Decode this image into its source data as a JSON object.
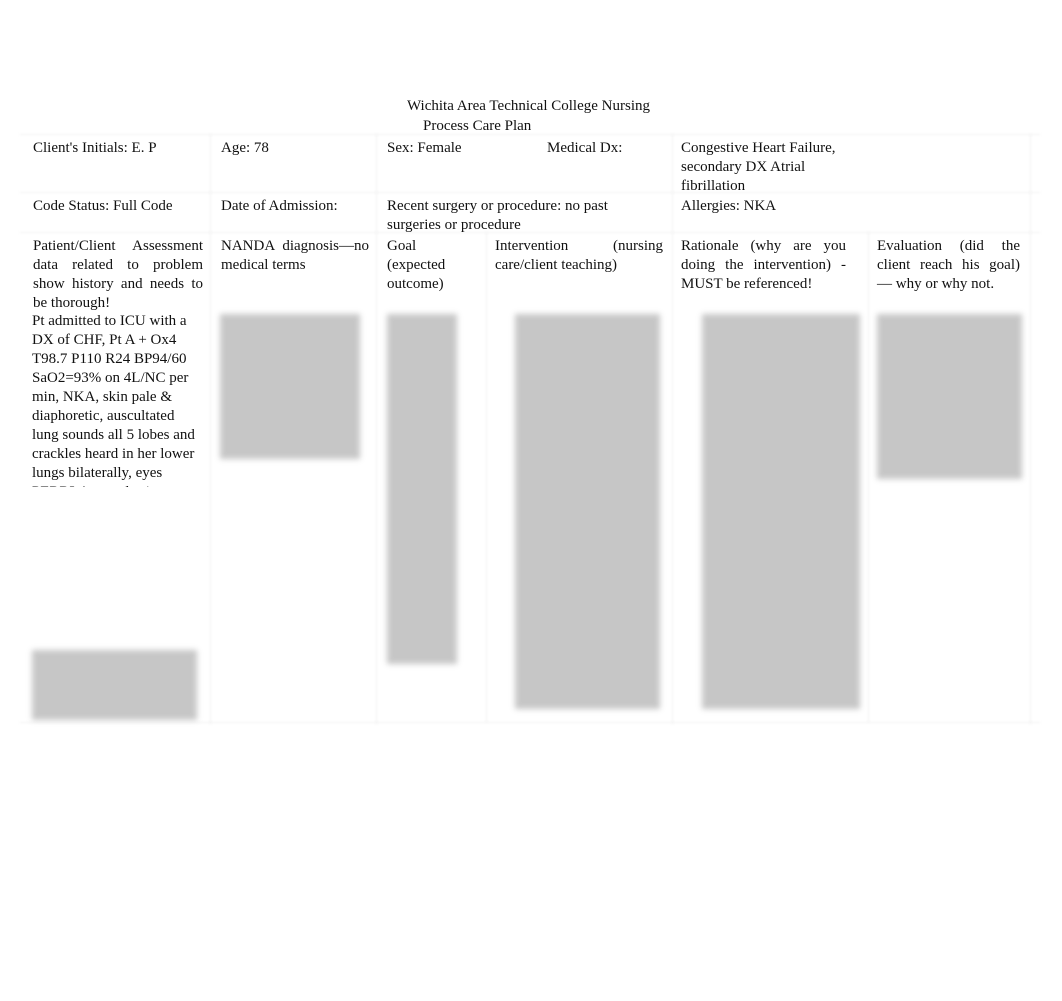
{
  "title": {
    "line1": "Wichita Area Technical College Nursing",
    "line2": "Process Care Plan"
  },
  "header": {
    "initials": "Client's Initials: E. P",
    "age": "Age: 78",
    "sex": "Sex: Female",
    "medical_dx_label": "Medical Dx:",
    "medical_dx_value": "Congestive Heart Failure, secondary DX Atrial fibrillation",
    "code_status": "Code Status: Full Code",
    "admission": "Date of Admission:",
    "surgery": "Recent surgery or procedure:  no past surgeries or procedure",
    "allergies": "Allergies: NKA"
  },
  "columns": [
    "Patient/Client Assessment data related to problem show history and needs to be thorough!",
    "NANDA diagnosis—no medical terms",
    "Goal (expected outcome)",
    "Intervention (nursing care/client teaching)",
    "Rationale (why are you doing the intervention) -MUST be referenced!",
    "Evaluation (did the client reach his goal) — why or why not."
  ],
  "assessment": "Pt admitted to ICU with a DX of CHF, Pt A + Ox4 T98.7 P110 R24 BP94/60 SaO2=93% on 4L/NC per min, NKA, skin pale & diaphoretic, auscultated lung sounds all 5 lobes and crackles heard in her lower lungs bilaterally, eyes PERRLA, equal grip"
}
